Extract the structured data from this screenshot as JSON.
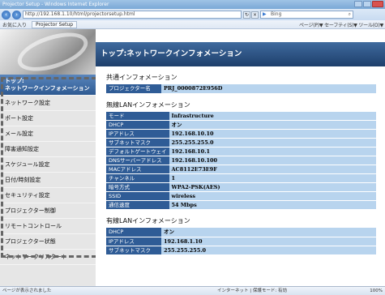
{
  "window": {
    "title": "Projector Setup - Windows Internet Explorer"
  },
  "addressbar": {
    "url": "http://192.168.1.10/html/projectorsetup.html",
    "search_placeholder": "Bing",
    "back_icon": "back-arrow-icon",
    "forward_icon": "forward-arrow-icon"
  },
  "cmdbar": {
    "favorites_label": "お気に入り",
    "tab_label": "Projector Setup",
    "right_tools": "ページ(P)▼ セーフティ(S)▼ ツール(O)▼"
  },
  "sidebar": {
    "items": [
      {
        "label": "トップ:",
        "label2": "ネットワークインフォメーション",
        "active": true
      },
      {
        "label": "ネットワーク設定"
      },
      {
        "label": "ポート設定"
      },
      {
        "label": "メール設定"
      },
      {
        "label": "障害通知設定"
      },
      {
        "label": "スケジュール設定"
      },
      {
        "label": "日付/時刻設定"
      },
      {
        "label": "セキュリティ設定"
      },
      {
        "label": "プロジェクター制御"
      },
      {
        "label": "リモートコントロール"
      },
      {
        "label": "プロジェクター状態"
      },
      {
        "label": "ネットワークリスタート"
      }
    ]
  },
  "main": {
    "page_title": "トップ:ネットワークインフォメーション",
    "sections": [
      {
        "title": "共通インフォメーション",
        "rows": [
          {
            "key": "プロジェクター名",
            "value": "PRJ_0000872E956D"
          }
        ]
      },
      {
        "title": "無線LANインフォメーション",
        "rows": [
          {
            "key": "モード",
            "value": "Infrastructure"
          },
          {
            "key": "DHCP",
            "value": "オン"
          },
          {
            "key": "IPアドレス",
            "value": "192.168.10.10"
          },
          {
            "key": "サブネットマスク",
            "value": "255.255.255.0"
          },
          {
            "key": "デフォルトゲートウェイ",
            "value": "192.168.10.1"
          },
          {
            "key": "DNSサーバーアドレス",
            "value": "192.168.10.100"
          },
          {
            "key": "MACアドレス",
            "value": "AC8112E73E9F"
          },
          {
            "key": "チャンネル",
            "value": "1"
          },
          {
            "key": "暗号方式",
            "value": "WPA2-PSK(AES)"
          },
          {
            "key": "SSID",
            "value": "wireless"
          },
          {
            "key": "通信速度",
            "value": "54 Mbps"
          }
        ]
      },
      {
        "title": "有線LANインフォメーション",
        "rows": [
          {
            "key": "DHCP",
            "value": "オン"
          },
          {
            "key": "IPアドレス",
            "value": "192.168.1.10"
          },
          {
            "key": "サブネットマスク",
            "value": "255.255.255.0"
          }
        ]
      }
    ]
  },
  "statusbar": {
    "left": "ページが表示されました",
    "mid": "インターネット | 保護モード: 有効",
    "right": "100%"
  }
}
